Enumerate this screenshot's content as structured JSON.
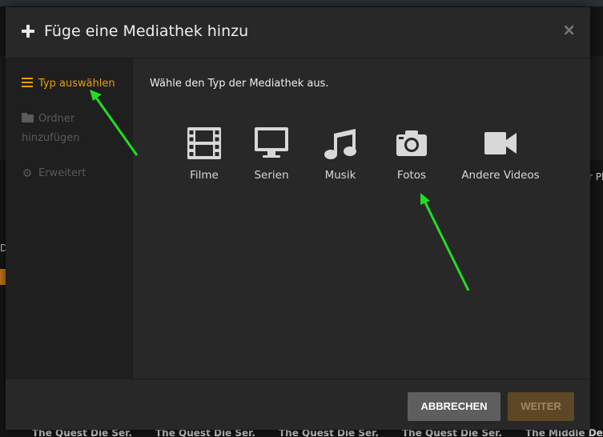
{
  "dialog": {
    "title": "Füge eine Mediathek hinzu",
    "close_glyph": "×"
  },
  "sidebar": {
    "items": [
      {
        "label": "Typ auswählen",
        "icon": "list-icon",
        "active": true
      },
      {
        "label": "Ordner hinzufügen",
        "icon": "folder-icon",
        "active": false
      },
      {
        "label": "Erweitert",
        "icon": "gear-icon",
        "active": false
      }
    ]
  },
  "main": {
    "prompt": "Wähle den Typ der Mediathek aus.",
    "types": [
      {
        "label": "Filme",
        "icon": "film-icon"
      },
      {
        "label": "Serien",
        "icon": "tv-icon"
      },
      {
        "label": "Musik",
        "icon": "music-note-icon"
      },
      {
        "label": "Fotos",
        "icon": "camera-icon"
      },
      {
        "label": "Andere Videos",
        "icon": "video-camera-icon"
      }
    ]
  },
  "footer": {
    "cancel_label": "ABBRECHEN",
    "next_label": "WEITER"
  },
  "background": {
    "side_text_right": "r Pl",
    "side_text_left": "D",
    "bottom_titles": [
      "The Quest Die Ser...",
      "The Quest Die Ser...",
      "The Quest Die Ser...",
      "The Quest Die Ser...",
      "The Middle Der..."
    ]
  },
  "colors": {
    "accent": "#e5a00d",
    "annotation_arrow": "#22dd22",
    "modal_bg": "#282828",
    "sidebar_bg": "#1f1f1f"
  }
}
